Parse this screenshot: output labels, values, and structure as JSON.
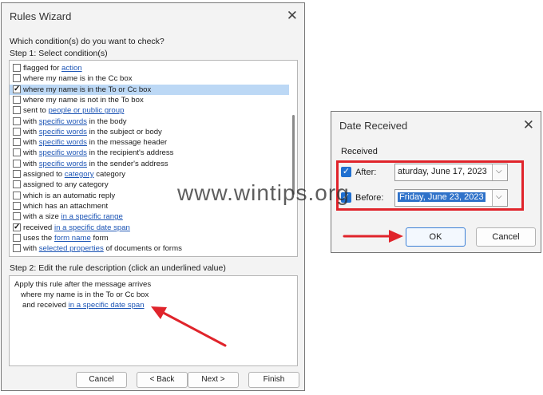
{
  "rules_wizard": {
    "title": "Rules Wizard",
    "question": "Which condition(s) do you want to check?",
    "step1": "Step 1: Select condition(s)",
    "conditions": [
      {
        "pre": "flagged for ",
        "link": "action",
        "post": "",
        "checked": false,
        "selected": false
      },
      {
        "pre": "where my name is in the Cc box",
        "link": "",
        "post": "",
        "checked": false,
        "selected": false
      },
      {
        "pre": "where my name is in the To or Cc box",
        "link": "",
        "post": "",
        "checked": true,
        "selected": true
      },
      {
        "pre": "where my name is not in the To box",
        "link": "",
        "post": "",
        "checked": false,
        "selected": false
      },
      {
        "pre": "sent to ",
        "link": "people or public group",
        "post": "",
        "checked": false,
        "selected": false
      },
      {
        "pre": "with ",
        "link": "specific words",
        "post": " in the body",
        "checked": false,
        "selected": false
      },
      {
        "pre": "with ",
        "link": "specific words",
        "post": " in the subject or body",
        "checked": false,
        "selected": false
      },
      {
        "pre": "with ",
        "link": "specific words",
        "post": " in the message header",
        "checked": false,
        "selected": false
      },
      {
        "pre": "with ",
        "link": "specific words",
        "post": " in the recipient's address",
        "checked": false,
        "selected": false
      },
      {
        "pre": "with ",
        "link": "specific words",
        "post": " in the sender's address",
        "checked": false,
        "selected": false
      },
      {
        "pre": "assigned to ",
        "link": "category",
        "post": " category",
        "checked": false,
        "selected": false
      },
      {
        "pre": "assigned to any category",
        "link": "",
        "post": "",
        "checked": false,
        "selected": false
      },
      {
        "pre": "which is an automatic reply",
        "link": "",
        "post": "",
        "checked": false,
        "selected": false
      },
      {
        "pre": "which has an attachment",
        "link": "",
        "post": "",
        "checked": false,
        "selected": false
      },
      {
        "pre": "with a size ",
        "link": "in a specific range",
        "post": "",
        "checked": false,
        "selected": false
      },
      {
        "pre": "received ",
        "link": "in a specific date span",
        "post": "",
        "checked": true,
        "selected": false
      },
      {
        "pre": "uses the ",
        "link": "form name",
        "post": " form",
        "checked": false,
        "selected": false
      },
      {
        "pre": "with ",
        "link": "selected properties",
        "post": " of documents or forms",
        "checked": false,
        "selected": false
      }
    ],
    "step2": "Step 2: Edit the rule description (click an underlined value)",
    "description": {
      "line1": "Apply this rule after the message arrives",
      "line2": "where my name is in the To or Cc box",
      "line3_pre": "and received ",
      "line3_link": "in a specific date span"
    },
    "buttons": {
      "cancel": "Cancel",
      "back": "< Back",
      "next": "Next >",
      "finish": "Finish"
    }
  },
  "date_received": {
    "title": "Date Received",
    "group_label": "Received",
    "after_label": "After:",
    "after_value": "aturday, June 17, 2023",
    "before_label": "Before:",
    "before_value": "Friday, June 23, 2023",
    "ok": "OK",
    "cancel": "Cancel"
  },
  "watermark": "www.wintips.org",
  "colors": {
    "accent": "#1f6fd0",
    "annotation_red": "#e0242b",
    "link": "#1d55b5",
    "selection": "#bcd8f5"
  }
}
